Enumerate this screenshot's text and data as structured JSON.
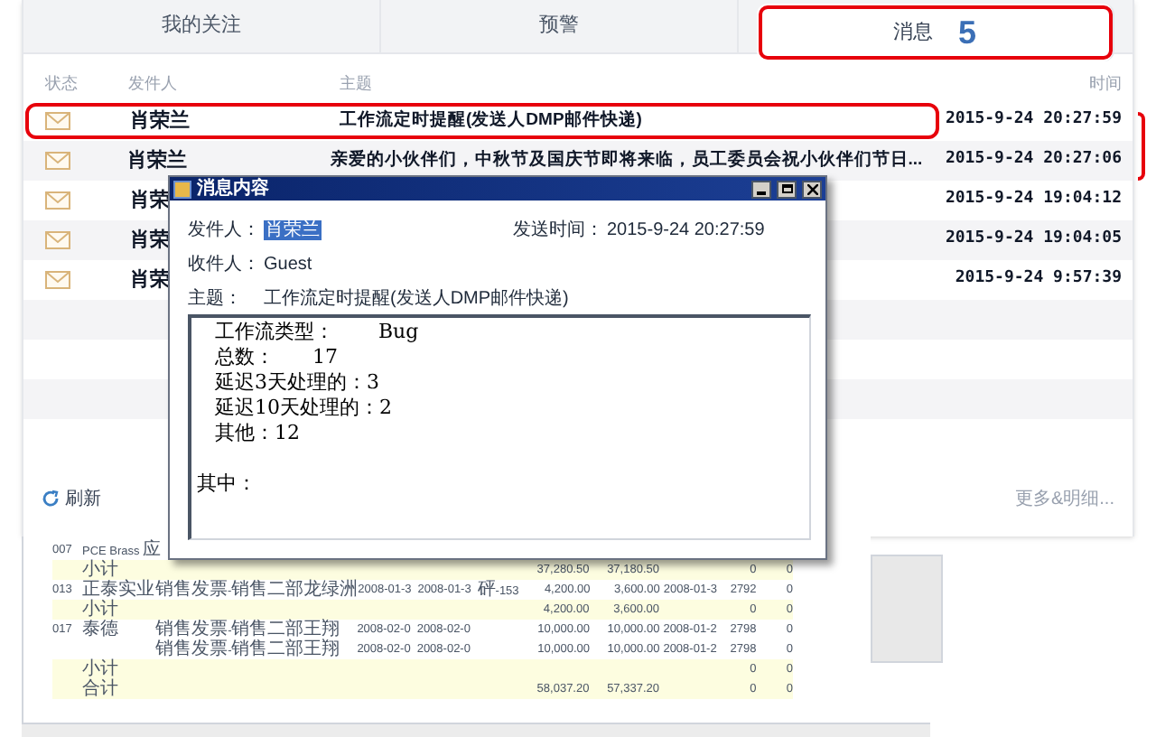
{
  "tabs": [
    {
      "label": "我的关注",
      "selected": false,
      "highlighted": false
    },
    {
      "label": "预警",
      "selected": false,
      "highlighted": false
    },
    {
      "label": "消息",
      "badge": "5",
      "selected": true,
      "highlighted": true
    }
  ],
  "messages": {
    "columns": [
      "状态",
      "发件人",
      "主题",
      "时间"
    ],
    "rows": [
      {
        "sender": "肖荣兰",
        "subject": "工作流定时提醒(发送人DMP邮件快递)",
        "time": "2015-9-24 20:27:59",
        "highlighted": true
      },
      {
        "sender": "肖荣兰",
        "subject": "亲爱的小伙伴们，中秋节及国庆节即将来临，员工委员会祝小伙伴们节日...",
        "time": "2015-9-24 20:27:06",
        "highlighted": false
      },
      {
        "sender": "肖荣",
        "time": "2015-9-24 19:04:12",
        "highlighted": false
      },
      {
        "sender": "肖荣",
        "time": "2015-9-24 19:04:05",
        "highlighted": false
      },
      {
        "sender": "肖荣",
        "time": "2015-9-24 9:57:39",
        "highlighted": false
      }
    ]
  },
  "refresh": "刷新",
  "more": "更多&明细...",
  "dialog": {
    "title": "消息内容",
    "sender_label": "发件人：",
    "sender": "肖荣兰",
    "sent_label": "发送时间：",
    "sent": "2015-9-24 20:27:59",
    "recipient_label": "收件人：",
    "recipient": "Guest",
    "subject_label": "主题：",
    "subject": "工作流定时提醒(发送人DMP邮件快递)",
    "body_lines": [
      "工作流类型：       Bug",
      "总数：      17",
      "延迟3天处理的：3",
      "延迟10天处理的：2",
      "其他：12"
    ],
    "body_footer": "其中："
  },
  "report": {
    "rows": [
      {
        "kind": "detail",
        "cells": [
          "007",
          "PCE Brass 应",
          "",
          "",
          "",
          "",
          "",
          "",
          "",
          "",
          "",
          ""
        ]
      },
      {
        "kind": "subtotal",
        "cells": [
          "",
          "小计",
          "",
          "",
          "",
          "",
          "",
          "37,280.50",
          "37,180.50",
          "",
          "0",
          "0"
        ]
      },
      {
        "kind": "detail",
        "cells": [
          "013",
          "正泰实业",
          "销售发票-销售二部",
          "龙绿洲",
          "2008-01-3",
          "2008-01-3",
          "砰-153",
          "4,200.00",
          "3,600.00",
          "2008-01-3",
          "2792",
          "0"
        ]
      },
      {
        "kind": "subtotal",
        "cells": [
          "",
          "小计",
          "",
          "",
          "",
          "",
          "",
          "4,200.00",
          "3,600.00",
          "",
          "0",
          "0"
        ]
      },
      {
        "kind": "detail",
        "cells": [
          "017",
          "泰德",
          "销售发票-销售二部",
          "王翔",
          "2008-02-0",
          "2008-02-0",
          "",
          "10,000.00",
          "10,000.00",
          "2008-01-2",
          "2798",
          "0"
        ]
      },
      {
        "kind": "detail",
        "cells": [
          "",
          "",
          "销售发票-销售二部",
          "王翔",
          "2008-02-0",
          "2008-02-0",
          "",
          "10,000.00",
          "10,000.00",
          "2008-01-2",
          "2798",
          "0"
        ]
      },
      {
        "kind": "subtotal",
        "cells": [
          "",
          "小计",
          "",
          "",
          "",
          "",
          "",
          "",
          "",
          "",
          "0",
          "0"
        ]
      },
      {
        "kind": "subtotal",
        "cells": [
          "",
          "合计",
          "",
          "",
          "",
          "",
          "",
          "58,037.20",
          "57,337.20",
          "",
          "0",
          "0"
        ]
      }
    ]
  }
}
